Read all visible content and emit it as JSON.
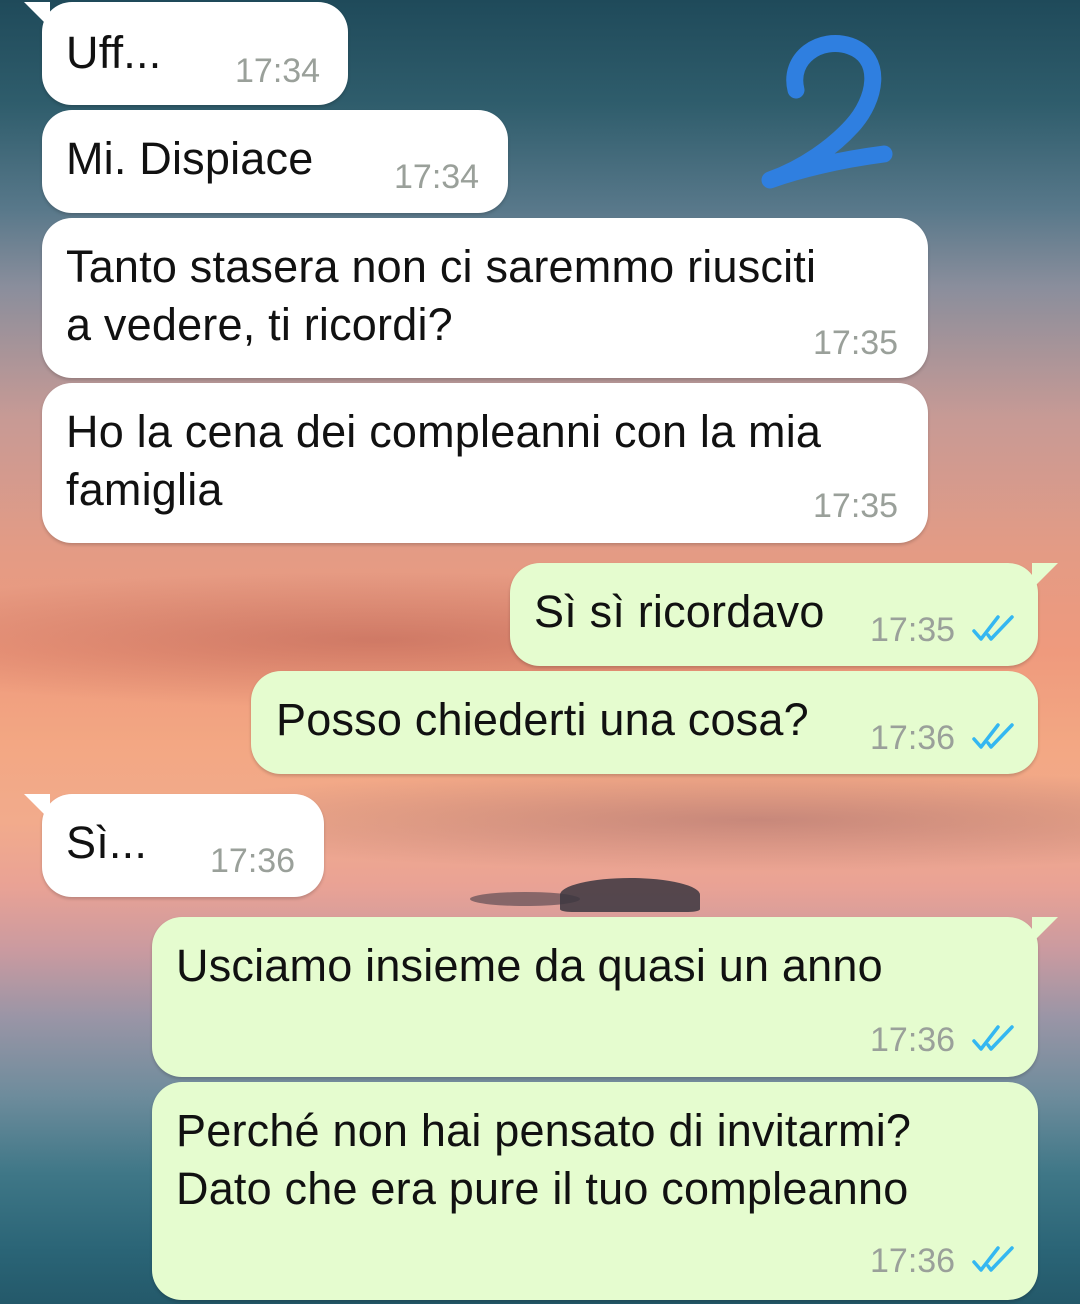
{
  "annotation": {
    "label": "2",
    "color": "#2f7fe0"
  },
  "colors": {
    "incoming_bubble": "#ffffff",
    "outgoing_bubble": "#e5fccf",
    "read_ticks": "#34b7f1"
  },
  "messages": [
    {
      "direction": "in",
      "text_lines": [
        "Uff..."
      ],
      "time": "17:34"
    },
    {
      "direction": "in",
      "text_lines": [
        "Mi. Dispiace"
      ],
      "time": "17:34"
    },
    {
      "direction": "in",
      "text_lines": [
        "Tanto stasera non ci saremmo riusciti",
        "a vedere, ti ricordi?"
      ],
      "time": "17:35"
    },
    {
      "direction": "in",
      "text_lines": [
        "Ho la cena dei compleanni con la mia",
        "famiglia"
      ],
      "time": "17:35"
    },
    {
      "direction": "out",
      "text_lines": [
        "Sì sì ricordavo"
      ],
      "time": "17:35",
      "status": "read"
    },
    {
      "direction": "out",
      "text_lines": [
        "Posso chiederti una cosa?"
      ],
      "time": "17:36",
      "status": "read"
    },
    {
      "direction": "in",
      "text_lines": [
        "Sì..."
      ],
      "time": "17:36"
    },
    {
      "direction": "out",
      "text_lines": [
        "Usciamo insieme da quasi un anno"
      ],
      "time": "17:36",
      "status": "read"
    },
    {
      "direction": "out",
      "text_lines": [
        "Perché non hai pensato di invitarmi?",
        "Dato che era pure il tuo compleanno"
      ],
      "time": "17:36",
      "status": "read"
    }
  ]
}
